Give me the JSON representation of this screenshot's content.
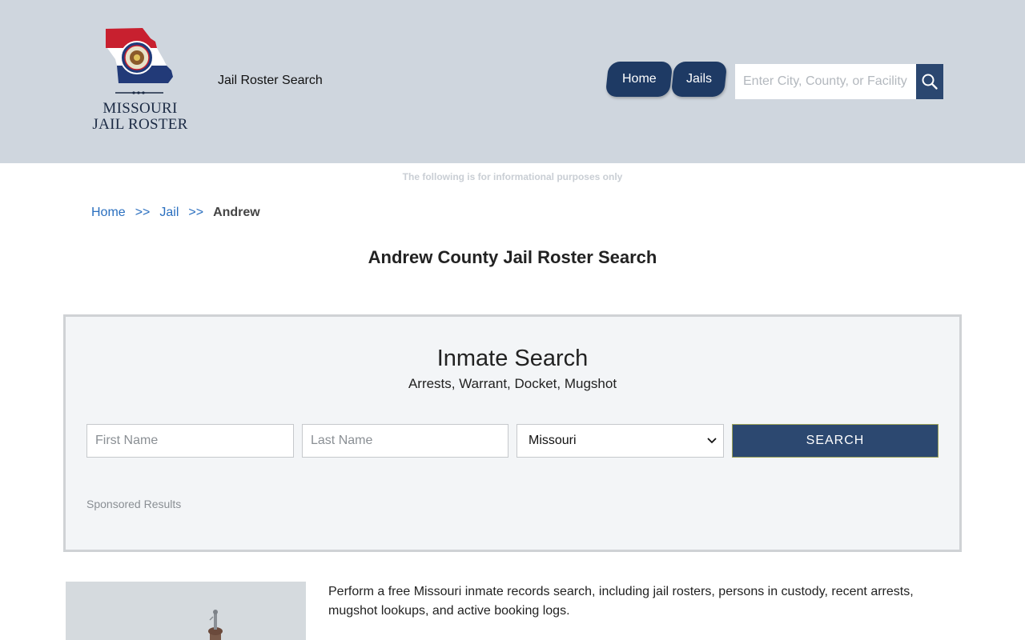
{
  "header": {
    "logo_text": [
      "MISSOURI",
      "JAIL ROSTER"
    ],
    "tagline": "Jail Roster Search",
    "nav": [
      {
        "label": "Home"
      },
      {
        "label": "Jails"
      }
    ],
    "search_placeholder": "Enter City, County, or Facility",
    "search_icon": "magnifier-icon",
    "bg_color": "#cfd6de",
    "nav_color": "#1e3a64"
  },
  "disclaimer": "The following is for informational purposes only",
  "breadcrumb": {
    "items": [
      {
        "label": "Home"
      },
      {
        "label": "Jail"
      }
    ],
    "separator": ">>",
    "current": "Andrew"
  },
  "page_title": "Andrew County Jail Roster Search",
  "search_panel": {
    "title": "Inmate Search",
    "subtitle": "Arrests, Warrant, Docket, Mugshot",
    "first_name_placeholder": "First Name",
    "last_name_placeholder": "Last Name",
    "state_selected": "Missouri",
    "search_button": "SEARCH",
    "sponsored": "Sponsored Results",
    "button_color": "#2c4870"
  },
  "intro": "Perform a free Missouri inmate records search, including jail rosters, persons in custody, recent arrests, mugshot lookups, and active booking logs."
}
